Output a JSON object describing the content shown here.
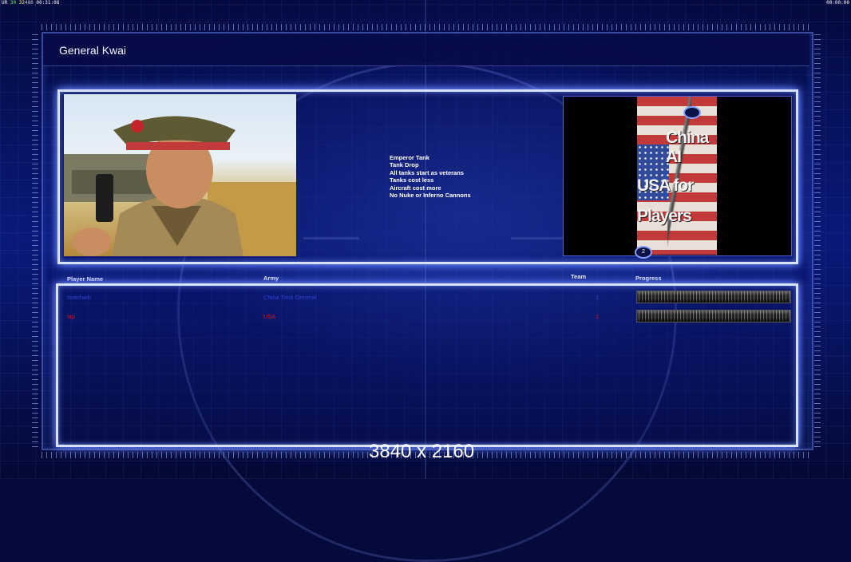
{
  "hud": {
    "left_prefix": "UR",
    "fps1": "30",
    "fps2": "32",
    "fps3": "480",
    "clock": "00:31:08",
    "right_clock": "00:00:00"
  },
  "general": {
    "title": "General Kwai",
    "features": [
      "Emperor Tank",
      "Tank Drop",
      "All tanks start as veterans",
      "Tanks cost less",
      "Aircraft cost more",
      "No Nuke or Inferno Cannons"
    ]
  },
  "map_preview": {
    "line1": "China AI",
    "line2": "USA for",
    "line3": "Players",
    "spawn_label": "2"
  },
  "table": {
    "headers": {
      "player": "Player Name",
      "army": "Army",
      "team": "Team",
      "progress": "Progress"
    },
    "rows": [
      {
        "player": "tsatchaib",
        "army": "China Tank General",
        "team": "1",
        "color": "#2c44d8",
        "progress": 1.0
      },
      {
        "player": "lap",
        "army": "USA",
        "team": "1",
        "color": "#d41818",
        "progress": 1.0
      }
    ]
  },
  "resolution_overlay": "3840 x 2160",
  "colors": {
    "panel_glow": "#6f8cff",
    "background": "#040a3a"
  }
}
